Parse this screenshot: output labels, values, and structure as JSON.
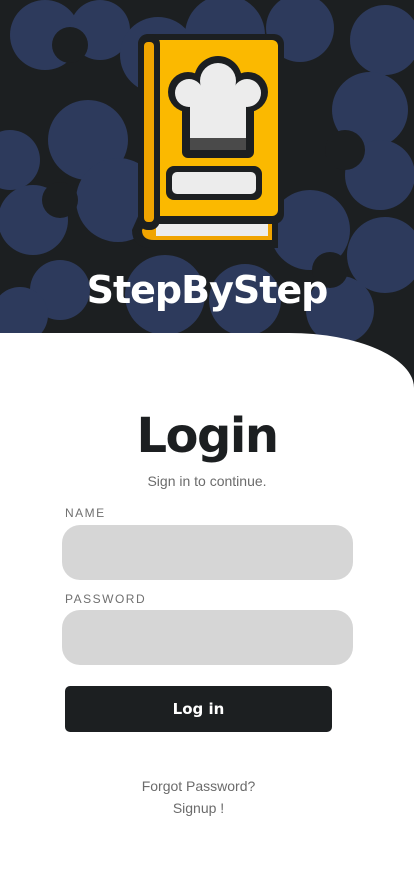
{
  "app": {
    "title": "StepByStep"
  },
  "colors": {
    "hero_bg": "#1c1f21",
    "pattern": "#2d3a5c",
    "accent": "#fbb900",
    "button_bg": "#1c1f21",
    "input_bg": "#d6d6d6"
  },
  "logo": {
    "icon": "cookbook-chef-hat-icon"
  },
  "login": {
    "heading": "Login",
    "subtitle": "Sign in to continue.",
    "name_label": "NAME",
    "name_value": "",
    "password_label": "PASSWORD",
    "password_value": "",
    "submit_label": "Log in",
    "forgot_link": "Forgot Password?",
    "signup_link": "Signup !"
  }
}
